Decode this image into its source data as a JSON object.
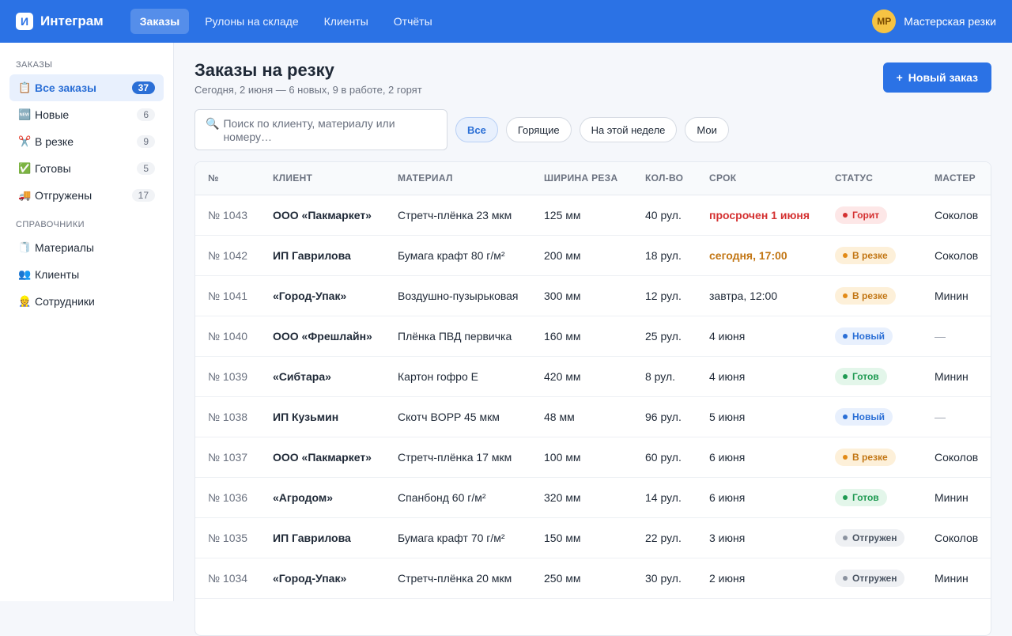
{
  "app": {
    "logo_letter": "И",
    "name": "Интеграм"
  },
  "nav": [
    {
      "label": "Заказы",
      "active": true
    },
    {
      "label": "Рулоны на складе",
      "active": false
    },
    {
      "label": "Клиенты",
      "active": false
    },
    {
      "label": "Отчёты",
      "active": false
    }
  ],
  "user": {
    "initials": "МР",
    "name": "Мастерская резки"
  },
  "sidebar": {
    "section_orders": "Заказы",
    "orders": [
      {
        "emoji": "📋",
        "label": "Все заказы",
        "count": "37",
        "active": true
      },
      {
        "emoji": "🆕",
        "label": "Новые",
        "count": "6",
        "active": false
      },
      {
        "emoji": "✂️",
        "label": "В резке",
        "count": "9",
        "active": false
      },
      {
        "emoji": "✅",
        "label": "Готовы",
        "count": "5",
        "active": false
      },
      {
        "emoji": "🚚",
        "label": "Отгружены",
        "count": "17",
        "active": false
      }
    ],
    "section_refs": "Справочники",
    "refs": [
      {
        "emoji": "🧻",
        "label": "Материалы"
      },
      {
        "emoji": "👥",
        "label": "Клиенты"
      },
      {
        "emoji": "👷",
        "label": "Сотрудники"
      }
    ]
  },
  "page": {
    "title": "Заказы на резку",
    "subtitle": "Сегодня, 2 июня — 6 новых, 9 в работе, 2 горят",
    "new_order_icon": "+",
    "new_order_label": "Новый заказ"
  },
  "search": {
    "icon": "🔍",
    "placeholder": "Поиск по клиенту, материалу или номеру…"
  },
  "filters": [
    {
      "label": "Все",
      "active": true
    },
    {
      "label": "Горящие",
      "active": false
    },
    {
      "label": "На этой неделе",
      "active": false
    },
    {
      "label": "Мои",
      "active": false
    }
  ],
  "table": {
    "columns": [
      "№",
      "Клиент",
      "Материал",
      "Ширина реза",
      "Кол-во",
      "Срок",
      "Статус",
      "Мастер"
    ],
    "rows": [
      {
        "num": "№ 1043",
        "client": "ООО «Пакмаркет»",
        "material": "Стретч-плёнка 23 мкм",
        "width": "125 мм",
        "qty": "40 рул.",
        "deadline": "просрочен 1 июня",
        "deadline_style": "overdue",
        "status": "Горит",
        "status_style": "hot",
        "master": "Соколов"
      },
      {
        "num": "№ 1042",
        "client": "ИП Гаврилова",
        "material": "Бумага крафт 80 г/м²",
        "width": "200 мм",
        "qty": "18 рул.",
        "deadline": "сегодня, 17:00",
        "deadline_style": "today",
        "status": "В резке",
        "status_style": "cutting",
        "master": "Соколов"
      },
      {
        "num": "№ 1041",
        "client": "«Город-Упак»",
        "material": "Воздушно-пузырьковая",
        "width": "300 мм",
        "qty": "12 рул.",
        "deadline": "завтра, 12:00",
        "deadline_style": "",
        "status": "В резке",
        "status_style": "cutting",
        "master": "Минин"
      },
      {
        "num": "№ 1040",
        "client": "ООО «Фрешлайн»",
        "material": "Плёнка ПВД первичка",
        "width": "160 мм",
        "qty": "25 рул.",
        "deadline": "4 июня",
        "deadline_style": "",
        "status": "Новый",
        "status_style": "new",
        "master": "—"
      },
      {
        "num": "№ 1039",
        "client": "«Сибтара»",
        "material": "Картон гофро E",
        "width": "420 мм",
        "qty": "8 рул.",
        "deadline": "4 июня",
        "deadline_style": "",
        "status": "Готов",
        "status_style": "ready",
        "master": "Минин"
      },
      {
        "num": "№ 1038",
        "client": "ИП Кузьмин",
        "material": "Скотч BOPP 45 мкм",
        "width": "48 мм",
        "qty": "96 рул.",
        "deadline": "5 июня",
        "deadline_style": "",
        "status": "Новый",
        "status_style": "new",
        "master": "—"
      },
      {
        "num": "№ 1037",
        "client": "ООО «Пакмаркет»",
        "material": "Стретч-плёнка 17 мкм",
        "width": "100 мм",
        "qty": "60 рул.",
        "deadline": "6 июня",
        "deadline_style": "",
        "status": "В резке",
        "status_style": "cutting",
        "master": "Соколов"
      },
      {
        "num": "№ 1036",
        "client": "«Агродом»",
        "material": "Спанбонд 60 г/м²",
        "width": "320 мм",
        "qty": "14 рул.",
        "deadline": "6 июня",
        "deadline_style": "",
        "status": "Готов",
        "status_style": "ready",
        "master": "Минин"
      },
      {
        "num": "№ 1035",
        "client": "ИП Гаврилова",
        "material": "Бумага крафт 70 г/м²",
        "width": "150 мм",
        "qty": "22 рул.",
        "deadline": "3 июня",
        "deadline_style": "",
        "status": "Отгружен",
        "status_style": "shipped",
        "master": "Соколов"
      },
      {
        "num": "№ 1034",
        "client": "«Город-Упак»",
        "material": "Стретч-плёнка 20 мкм",
        "width": "250 мм",
        "qty": "30 рул.",
        "deadline": "2 июня",
        "deadline_style": "",
        "status": "Отгружен",
        "status_style": "shipped",
        "master": "Минин"
      }
    ]
  }
}
